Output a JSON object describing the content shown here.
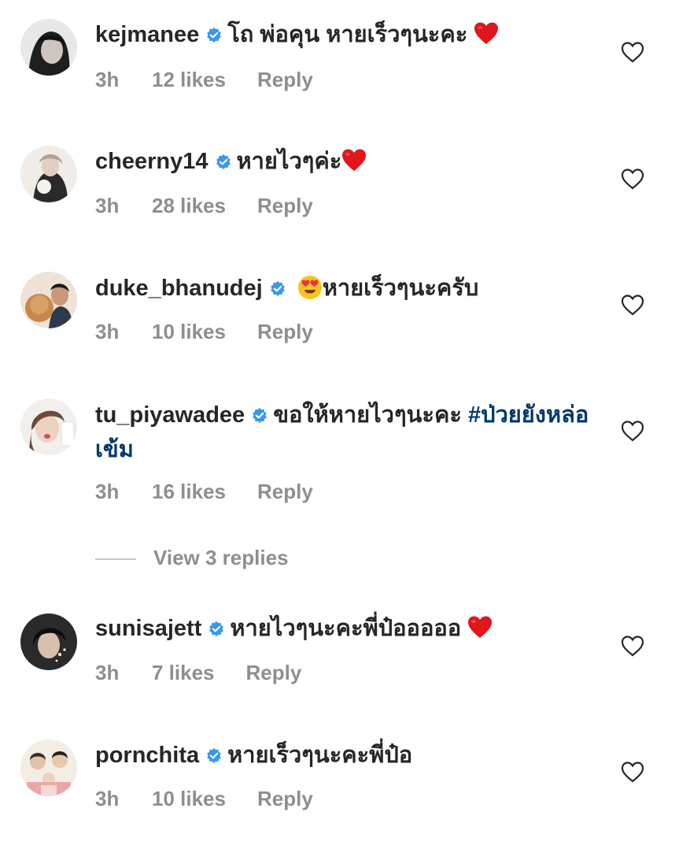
{
  "comments": [
    {
      "username": "kejmanee",
      "text": "โถ พ่อคุน หายเร็วๆนะคะ",
      "emoji_after": "heart",
      "time": "3h",
      "likes": "12 likes",
      "reply": "Reply",
      "avatar_color": "#2b2b2b"
    },
    {
      "username": "cheerny14",
      "text": "หายไวๆค่ะ",
      "emoji_after": "heart",
      "time": "3h",
      "likes": "28 likes",
      "reply": "Reply",
      "avatar_color": "#d9d2cc"
    },
    {
      "username": "duke_bhanudej",
      "emoji_before": "heart-eyes",
      "text": "หายเร็วๆนะครับ",
      "time": "3h",
      "likes": "10 likes",
      "reply": "Reply",
      "avatar_color": "#c89a6a"
    },
    {
      "username": "tu_piyawadee",
      "text": "ขอให้หายไวๆนะคะ",
      "hashtag": "#ป่วยยังหล่อเข้ม",
      "time": "3h",
      "likes": "16 likes",
      "reply": "Reply",
      "avatar_color": "#e6ded8"
    },
    {
      "username": "sunisajett",
      "text": "หายไวๆนะคะพี่ป๋อออออ",
      "emoji_after": "heart",
      "time": "3h",
      "likes": "7 likes",
      "reply": "Reply",
      "avatar_color": "#3a3a3a"
    },
    {
      "username": "pornchita",
      "text": "หายเร็วๆนะคะพี่ป๋อ",
      "time": "3h",
      "likes": "10 likes",
      "reply": "Reply",
      "avatar_color": "#e9e1d6"
    }
  ],
  "view_replies": "View 3 replies",
  "colors": {
    "username": "#262626",
    "meta": "#8e8e8e",
    "verified": "#3897f0",
    "hashtag": "#00376b",
    "heart_emoji": "#e0161d"
  },
  "icons": {
    "verified": "verified-badge-icon",
    "like": "heart-outline-icon"
  }
}
